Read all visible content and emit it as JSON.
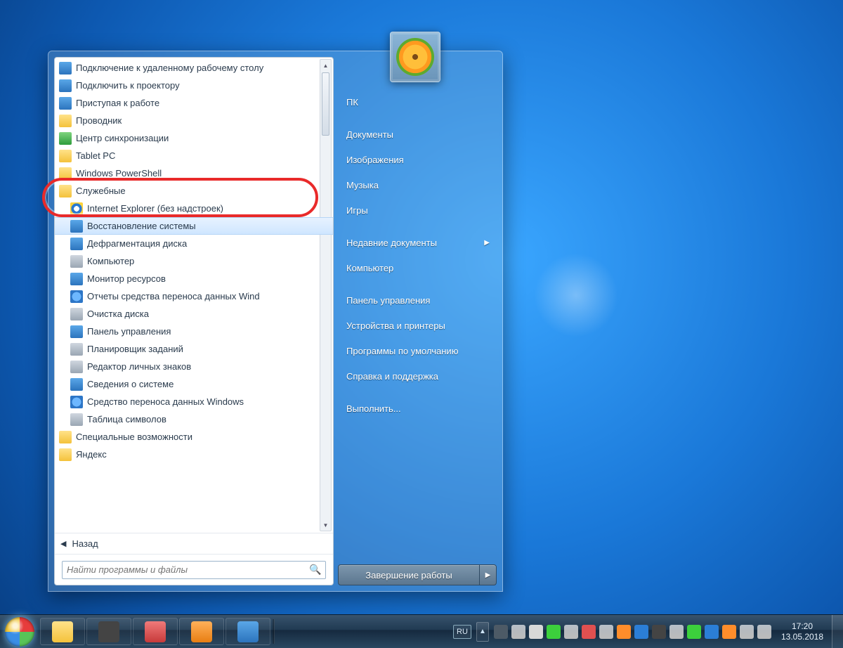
{
  "user_picture": "flower-avatar",
  "start_menu": {
    "left": {
      "items": [
        {
          "label": "Подключение к удаленному рабочему столу",
          "icon": "ic-blue",
          "indent": 0
        },
        {
          "label": "Подключить к проектору",
          "icon": "ic-blue",
          "indent": 0
        },
        {
          "label": "Приступая к работе",
          "icon": "ic-blue",
          "indent": 0
        },
        {
          "label": "Проводник",
          "icon": "ic-yellow",
          "indent": 0
        },
        {
          "label": "Центр синхронизации",
          "icon": "ic-green",
          "indent": 0
        },
        {
          "label": "Tablet PC",
          "icon": "ic-yellow",
          "indent": 0
        },
        {
          "label": "Windows PowerShell",
          "icon": "ic-yellow",
          "indent": 0
        },
        {
          "label": "Служебные",
          "icon": "ic-yellow",
          "indent": 0
        },
        {
          "label": "Internet Explorer (без надстроек)",
          "icon": "ic-ie",
          "indent": 1
        },
        {
          "label": "Восстановление системы",
          "icon": "ic-blue",
          "indent": 1,
          "highlight": true
        },
        {
          "label": "Дефрагментация диска",
          "icon": "ic-blue",
          "indent": 1
        },
        {
          "label": "Компьютер",
          "icon": "ic-gray",
          "indent": 1
        },
        {
          "label": "Монитор ресурсов",
          "icon": "ic-blue",
          "indent": 1
        },
        {
          "label": "Отчеты средства переноса данных Wind",
          "icon": "ic-globe",
          "indent": 1
        },
        {
          "label": "Очистка диска",
          "icon": "ic-gray",
          "indent": 1
        },
        {
          "label": "Панель управления",
          "icon": "ic-blue",
          "indent": 1
        },
        {
          "label": "Планировщик заданий",
          "icon": "ic-gray",
          "indent": 1
        },
        {
          "label": "Редактор личных знаков",
          "icon": "ic-gray",
          "indent": 1
        },
        {
          "label": "Сведения о системе",
          "icon": "ic-blue",
          "indent": 1
        },
        {
          "label": "Средство переноса данных Windows",
          "icon": "ic-globe",
          "indent": 1
        },
        {
          "label": "Таблица символов",
          "icon": "ic-gray",
          "indent": 1
        },
        {
          "label": "Специальные возможности",
          "icon": "ic-yellow",
          "indent": 0
        },
        {
          "label": "Яндекс",
          "icon": "ic-yellow",
          "indent": -1
        }
      ],
      "back_label": "Назад",
      "search_placeholder": "Найти программы и файлы"
    },
    "right": {
      "items": [
        {
          "label": "ПК"
        },
        {
          "label": "Документы"
        },
        {
          "label": "Изображения"
        },
        {
          "label": "Музыка"
        },
        {
          "label": "Игры"
        },
        {
          "label": "Недавние документы",
          "submenu": true
        },
        {
          "label": "Компьютер"
        },
        {
          "label": "Панель управления"
        },
        {
          "label": "Устройства и принтеры"
        },
        {
          "label": "Программы по умолчанию"
        },
        {
          "label": "Справка и поддержка"
        },
        {
          "label": "Выполнить..."
        }
      ],
      "shutdown_label": "Завершение работы"
    }
  },
  "taskbar": {
    "pinned": [
      {
        "name": "explorer",
        "color": "ic-yellow"
      },
      {
        "name": "panda",
        "color": "c7"
      },
      {
        "name": "opera",
        "color": "ic-red"
      },
      {
        "name": "firefox",
        "color": "ic-orange"
      },
      {
        "name": "skype",
        "color": "ic-blue"
      }
    ],
    "lang": "RU",
    "tray_icons": 16,
    "clock": {
      "time": "17:20",
      "date": "13.05.2018"
    }
  }
}
